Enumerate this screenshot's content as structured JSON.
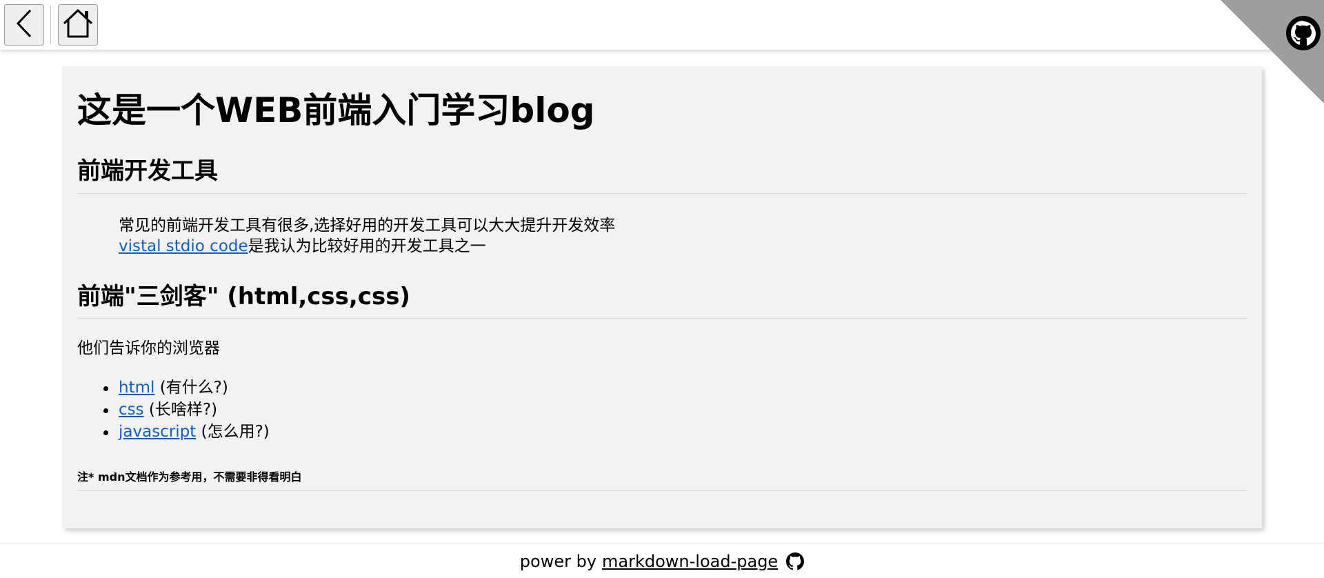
{
  "header": {
    "back_icon": "chevron-left-icon",
    "home_icon": "home-icon",
    "github_corner_icon": "github-icon"
  },
  "content": {
    "title": "这是一个WEB前端入门学习blog",
    "section1": {
      "heading": "前端开发工具",
      "quote_line1": "常见的前端开发工具有很多,选择好用的开发工具可以大大提升开发效率",
      "quote_link": "vistal stdio code",
      "quote_line2_suffix": "是我认为比较好用的开发工具之一"
    },
    "section2": {
      "heading": "前端\"三剑客\" (html,css,css)",
      "intro": "他们告诉你的浏览器",
      "items": [
        {
          "link": "html",
          "note": " (有什么?)"
        },
        {
          "link": "css",
          "note": " (长啥样?)"
        },
        {
          "link": "javascript",
          "note": " (怎么用?)"
        }
      ],
      "footnote": "注*  mdn文档作为参考用，不需要非得看明白"
    }
  },
  "footer": {
    "prefix": "power by",
    "link": "markdown-load-page",
    "icon": "github-icon"
  },
  "colors": {
    "link": "#0b5ed7",
    "panel_bg": "#f2f2f2",
    "corner": "#9e9e9e"
  }
}
